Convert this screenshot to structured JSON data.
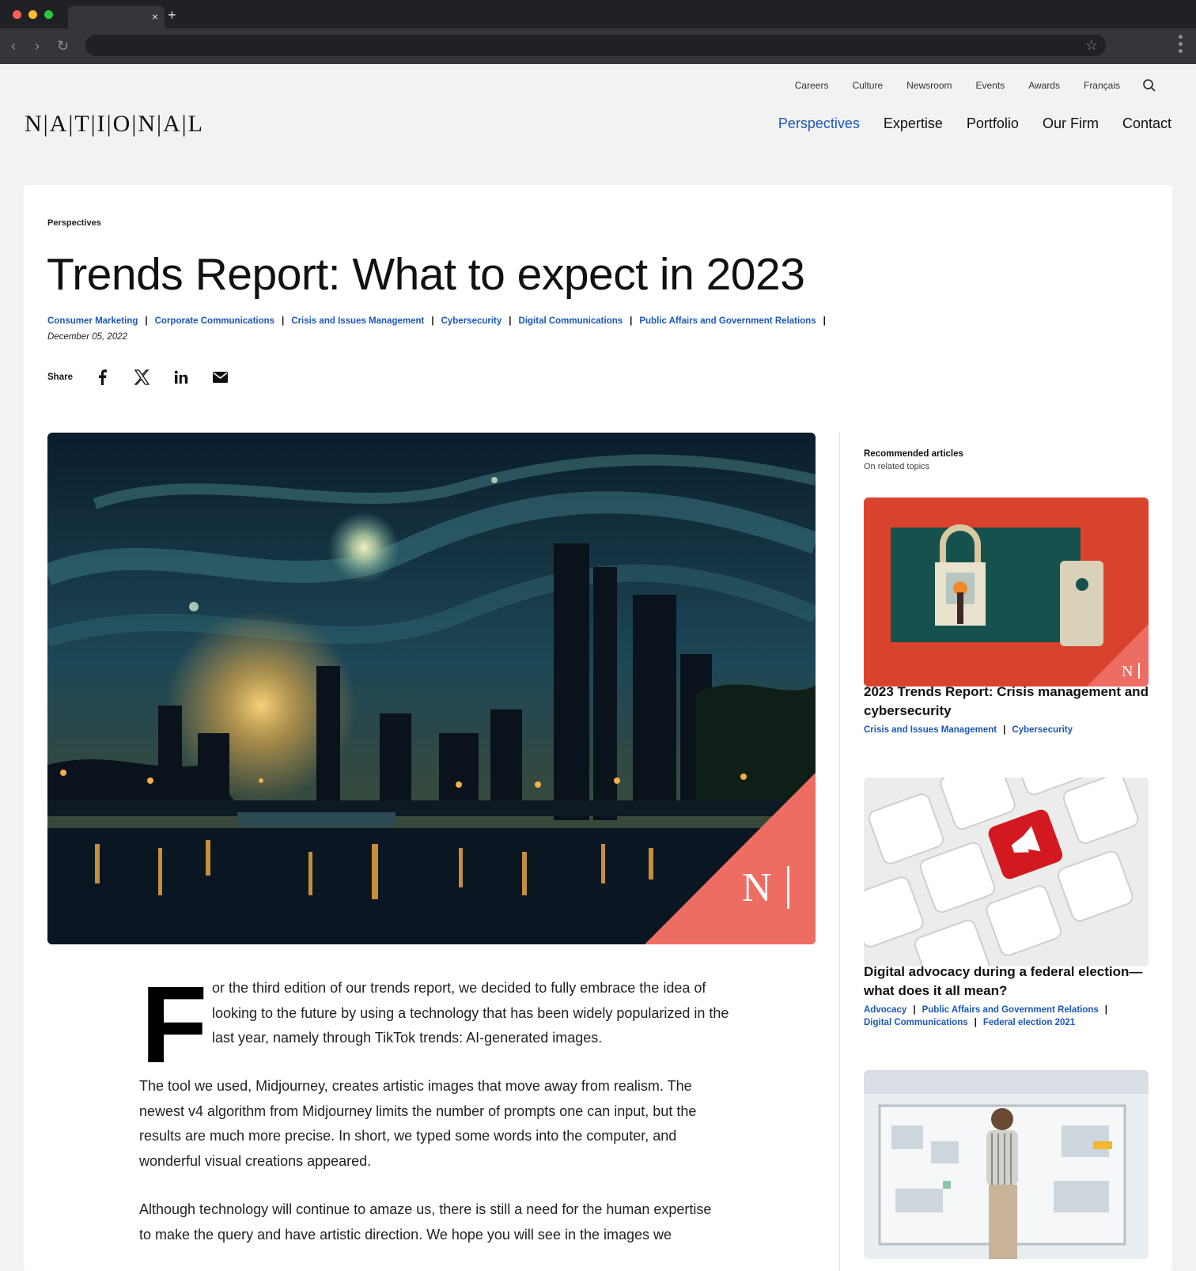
{
  "browser": {
    "tab_close": "×",
    "new_tab": "+"
  },
  "utility_nav": [
    "Careers",
    "Culture",
    "Newsroom",
    "Events",
    "Awards",
    "Français"
  ],
  "logo": "N|A|T|I|O|N|A|L",
  "main_nav": [
    {
      "label": "Perspectives",
      "active": true
    },
    {
      "label": "Expertise",
      "active": false
    },
    {
      "label": "Portfolio",
      "active": false
    },
    {
      "label": "Our Firm",
      "active": false
    },
    {
      "label": "Contact",
      "active": false
    }
  ],
  "article": {
    "breadcrumb": "Perspectives",
    "title": "Trends Report: What to expect in 2023",
    "tags": [
      "Consumer Marketing",
      "Corporate Communications",
      "Crisis and Issues Management",
      "Cybersecurity",
      "Digital Communications",
      "Public Affairs and Government Relations"
    ],
    "tag_separator": "|",
    "date": "December 05, 2022",
    "share_label": "Share",
    "dropcap": "F",
    "para1": "or the third edition of our trends report, we decided to fully embrace the idea of looking to the future by using a technology that has been widely popularized in the last year, namely through TikTok trends: AI-generated images.",
    "para2": "The tool we used, Midjourney, creates artistic images that move away from realism. The newest v4 algorithm from Midjourney limits the number of prompts one can input, but the results are much more precise. In short, we typed some words into the computer, and wonderful visual creations appeared.",
    "para3": "Although technology will continue to amaze us, there is still a need for the human expertise to make the query and have artistic direction. We hope you will see in the images we"
  },
  "sidebar": {
    "heading": "Recommended articles",
    "subheading": "On related topics",
    "items": [
      {
        "title": "2023 Trends Report: Crisis management and cybersecurity",
        "tags": [
          "Crisis and Issues Management",
          "Cybersecurity"
        ]
      },
      {
        "title": "Digital advocacy during a federal election—what does it all mean?",
        "tags_line1": [
          "Advocacy",
          "Public Affairs and Government Relations"
        ],
        "tags_line2": [
          "Digital Communications",
          "Federal election 2021"
        ]
      }
    ],
    "watermark": "N"
  },
  "colors": {
    "accent_blue": "#1b57b8",
    "brand_coral": "#ee6d62"
  }
}
